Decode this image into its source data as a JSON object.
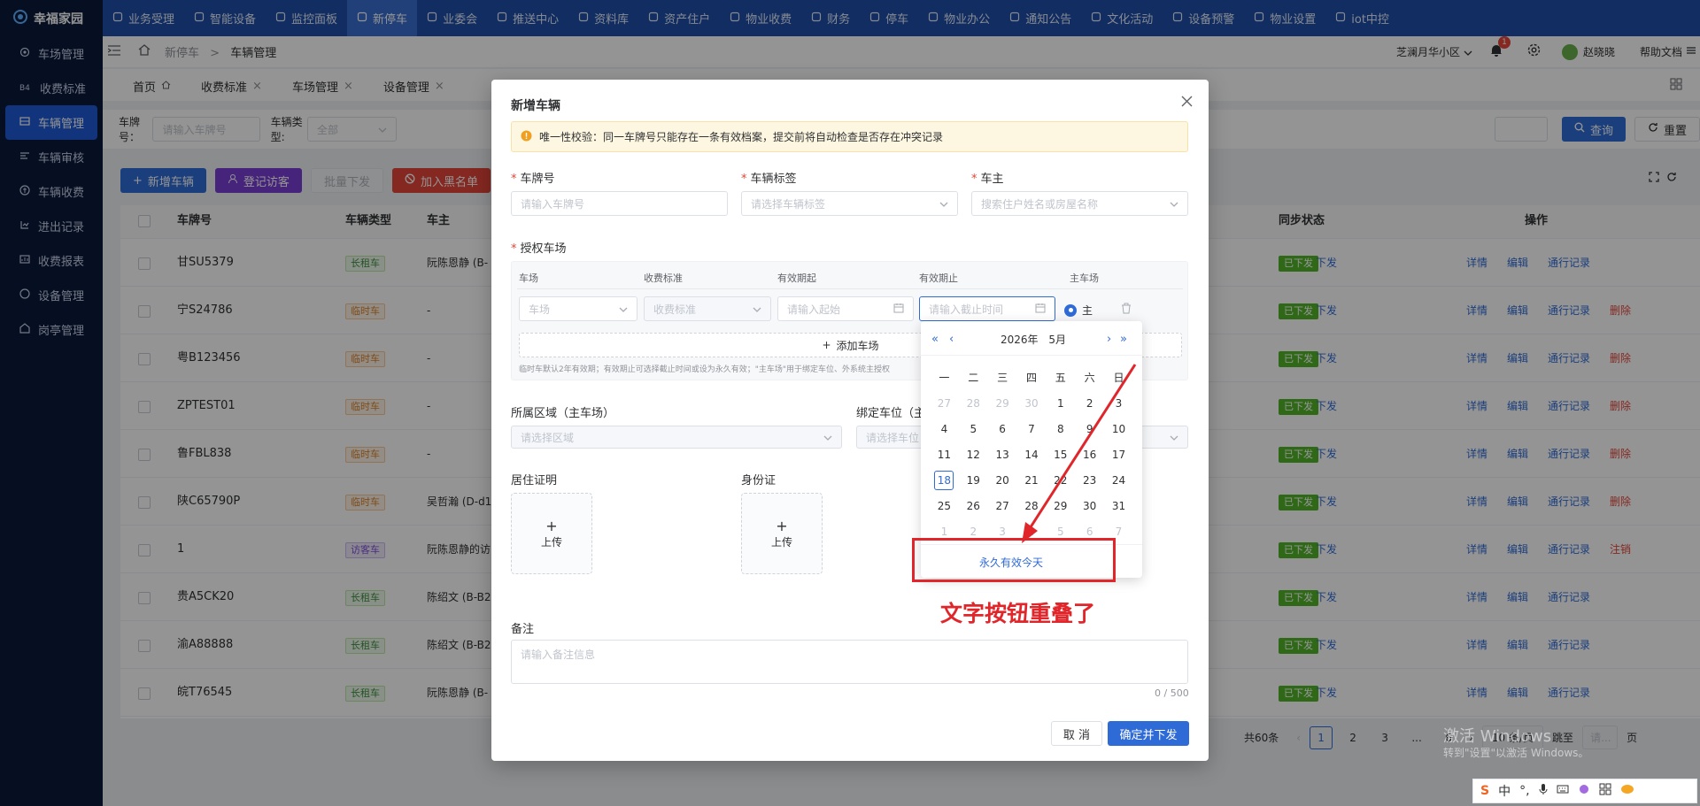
{
  "app": {
    "name": "幸福家园"
  },
  "topnav": [
    "业务受理",
    "智能设备",
    "监控面板",
    "新停车",
    "业委会",
    "推送中心",
    "资料库",
    "资产住户",
    "物业收费",
    "财务",
    "停车",
    "物业办公",
    "通知公告",
    "文化活动",
    "设备预警",
    "物业设置",
    "iot中控"
  ],
  "topnav_active": 3,
  "sidebar": [
    {
      "label": "车场管理",
      "icon": "gear"
    },
    {
      "label": "收费标准",
      "icon": "b4"
    },
    {
      "label": "车辆管理",
      "icon": "car"
    },
    {
      "label": "车辆审核",
      "icon": "audit"
    },
    {
      "label": "车辆收费",
      "icon": "coin"
    },
    {
      "label": "进出记录",
      "icon": "log"
    },
    {
      "label": "收费报表",
      "icon": "report"
    },
    {
      "label": "设备管理",
      "icon": "device"
    },
    {
      "label": "岗亭管理",
      "icon": "booth"
    }
  ],
  "sidebar_active": 2,
  "header": {
    "breadcrumb_parent": "新停车",
    "breadcrumb_sep": ">",
    "breadcrumb_current": "车辆管理",
    "community": "芝澜月华小区",
    "notif_count": "1",
    "user": "赵晓晓",
    "help": "帮助文档"
  },
  "tabs": [
    {
      "label": "首页",
      "closable": false
    },
    {
      "label": "收费标准",
      "closable": true
    },
    {
      "label": "车场管理",
      "closable": true
    },
    {
      "label": "设备管理",
      "closable": true
    }
  ],
  "filter": {
    "plate_label": "车牌号：",
    "plate_placeholder": "请输入车牌号",
    "type_label": "车辆类型:",
    "type_value": "全部",
    "search_btn": "查询",
    "reset_btn": "重置"
  },
  "toolbar": {
    "add": "新增车辆",
    "visitor": "登记访客",
    "batch": "批量下发",
    "blacklist": "加入黑名单"
  },
  "table": {
    "headers": [
      "车牌号",
      "车辆类型",
      "车主",
      "同步状态",
      "操作"
    ],
    "rows": [
      {
        "plate": "甘SU5379",
        "type": "长租车",
        "type_color": "g",
        "owner": "阮陈恩静 (B-",
        "sync": "已下发",
        "ops": [
          "详情",
          "编辑",
          "通行记录"
        ]
      },
      {
        "plate": "宁S24786",
        "type": "临时车",
        "type_color": "o",
        "owner": "-",
        "sync": "已下发",
        "ops": [
          "详情",
          "编辑",
          "通行记录",
          "删除"
        ]
      },
      {
        "plate": "粤B123456",
        "type": "临时车",
        "type_color": "o",
        "owner": "-",
        "sync": "已下发",
        "ops": [
          "详情",
          "编辑",
          "通行记录",
          "删除"
        ]
      },
      {
        "plate": "ZPTEST01",
        "type": "临时车",
        "type_color": "o",
        "owner": "-",
        "sync": "已下发",
        "ops": [
          "详情",
          "编辑",
          "通行记录",
          "删除"
        ]
      },
      {
        "plate": "鲁FBL838",
        "type": "临时车",
        "type_color": "o",
        "owner": "-",
        "sync": "已下发",
        "ops": [
          "详情",
          "编辑",
          "通行记录",
          "删除"
        ]
      },
      {
        "plate": "陕C65790P",
        "type": "临时车",
        "type_color": "o",
        "owner": "吴哲瀚 (D-d1",
        "sync": "已下发",
        "ops": [
          "详情",
          "编辑",
          "通行记录",
          "删除"
        ]
      },
      {
        "plate": "1",
        "type": "访客车",
        "type_color": "p",
        "owner": "阮陈恩静的访",
        "sync": "已下发",
        "ops": [
          "详情",
          "编辑",
          "通行记录",
          "注销"
        ]
      },
      {
        "plate": "贵A5CK20",
        "type": "长租车",
        "type_color": "g",
        "owner": "陈绍文 (B-B2",
        "sync": "已下发",
        "ops": [
          "详情",
          "编辑",
          "通行记录"
        ]
      },
      {
        "plate": "渝A88888",
        "type": "长租车",
        "type_color": "g",
        "owner": "陈绍文 (B-B2",
        "sync": "已下发",
        "ops": [
          "详情",
          "编辑",
          "通行记录"
        ]
      },
      {
        "plate": "皖T76545",
        "type": "长租车",
        "type_color": "g",
        "owner": "阮陈恩静 (B-",
        "sync": "已下发",
        "ops": [
          "详情",
          "编辑",
          "通行记录"
        ]
      }
    ],
    "sync_action": "下发"
  },
  "pagination": {
    "total": "共60条",
    "pages": [
      "1",
      "2",
      "3",
      "...",
      "6"
    ],
    "current": "1",
    "page_size": "10 条/页",
    "jump": "跳至",
    "jump_placeholder": "请...",
    "page_unit": "页"
  },
  "modal": {
    "title": "新增车辆",
    "notice": "唯一性校验：同一车牌号只能存在一条有效档案，提交前将自动检查是否存在冲突记录",
    "plate_label": "车牌号",
    "plate_placeholder": "请输入车牌号",
    "tag_label": "车辆标签",
    "tag_placeholder": "请选择车辆标签",
    "owner_label": "车主",
    "owner_placeholder": "搜索住户姓名或房屋名称",
    "auth_label": "授权车场",
    "auth_cols": [
      "车场",
      "收费标准",
      "有效期起",
      "有效期止",
      "主车场"
    ],
    "lot_placeholder": "车场",
    "fee_placeholder": "收费标准",
    "start_placeholder": "请输入起始",
    "end_placeholder": "请输入截止时间",
    "main_label": "主",
    "add_lot": "添加车场",
    "hint": "临时车默认2年有效期；有效期止可选择截止时间或设为永久有效；\"主车场\"用于绑定车位、外系统主授权",
    "area_label": "所属区域（主车场）",
    "area_placeholder": "请选择区域",
    "space_label": "绑定车位（主",
    "space_placeholder": "请选择车位",
    "residence_label": "居住证明",
    "idcard_label": "身份证",
    "upload": "上传",
    "remark_label": "备注",
    "remark_placeholder": "请输入备注信息",
    "remark_count": "0 / 500",
    "cancel": "取 消",
    "confirm": "确定并下发"
  },
  "datepicker": {
    "year": "2026年",
    "month": "5月",
    "weekdays": [
      "一",
      "二",
      "三",
      "四",
      "五",
      "六",
      "日"
    ],
    "weeks": [
      [
        [
          "27",
          1
        ],
        [
          "28",
          1
        ],
        [
          "29",
          1
        ],
        [
          "30",
          1
        ],
        [
          "1",
          0
        ],
        [
          "2",
          0
        ],
        [
          "3",
          0
        ]
      ],
      [
        [
          "4",
          0
        ],
        [
          "5",
          0
        ],
        [
          "6",
          0
        ],
        [
          "7",
          0
        ],
        [
          "8",
          0
        ],
        [
          "9",
          0
        ],
        [
          "10",
          0
        ]
      ],
      [
        [
          "11",
          0
        ],
        [
          "12",
          0
        ],
        [
          "13",
          0
        ],
        [
          "14",
          0
        ],
        [
          "15",
          0
        ],
        [
          "16",
          0
        ],
        [
          "17",
          0
        ]
      ],
      [
        [
          "18",
          2
        ],
        [
          "19",
          0
        ],
        [
          "20",
          0
        ],
        [
          "21",
          0
        ],
        [
          "22",
          0
        ],
        [
          "23",
          0
        ],
        [
          "24",
          0
        ]
      ],
      [
        [
          "25",
          0
        ],
        [
          "26",
          0
        ],
        [
          "27",
          0
        ],
        [
          "28",
          0
        ],
        [
          "29",
          0
        ],
        [
          "30",
          0
        ],
        [
          "31",
          0
        ]
      ],
      [
        [
          "1",
          1
        ],
        [
          "2",
          1
        ],
        [
          "3",
          1
        ],
        [
          "4",
          1
        ],
        [
          "5",
          1
        ],
        [
          "6",
          1
        ],
        [
          "7",
          1
        ]
      ]
    ],
    "footer": "永久有效今天"
  },
  "annotation": {
    "text": "文字按钮重叠了",
    "color": "#e0262a"
  },
  "watermark": {
    "line1": "激活 Windows",
    "line2": "转到\"设置\"以激活 Windows。"
  },
  "ime": {
    "items": [
      "中",
      "°,"
    ]
  },
  "colors": {
    "primary": "#2f6bd6",
    "topbar": "#1f4fa8",
    "sidebar": "#0c1a3c",
    "danger": "#e4463a",
    "purple": "#7b3fd4"
  }
}
